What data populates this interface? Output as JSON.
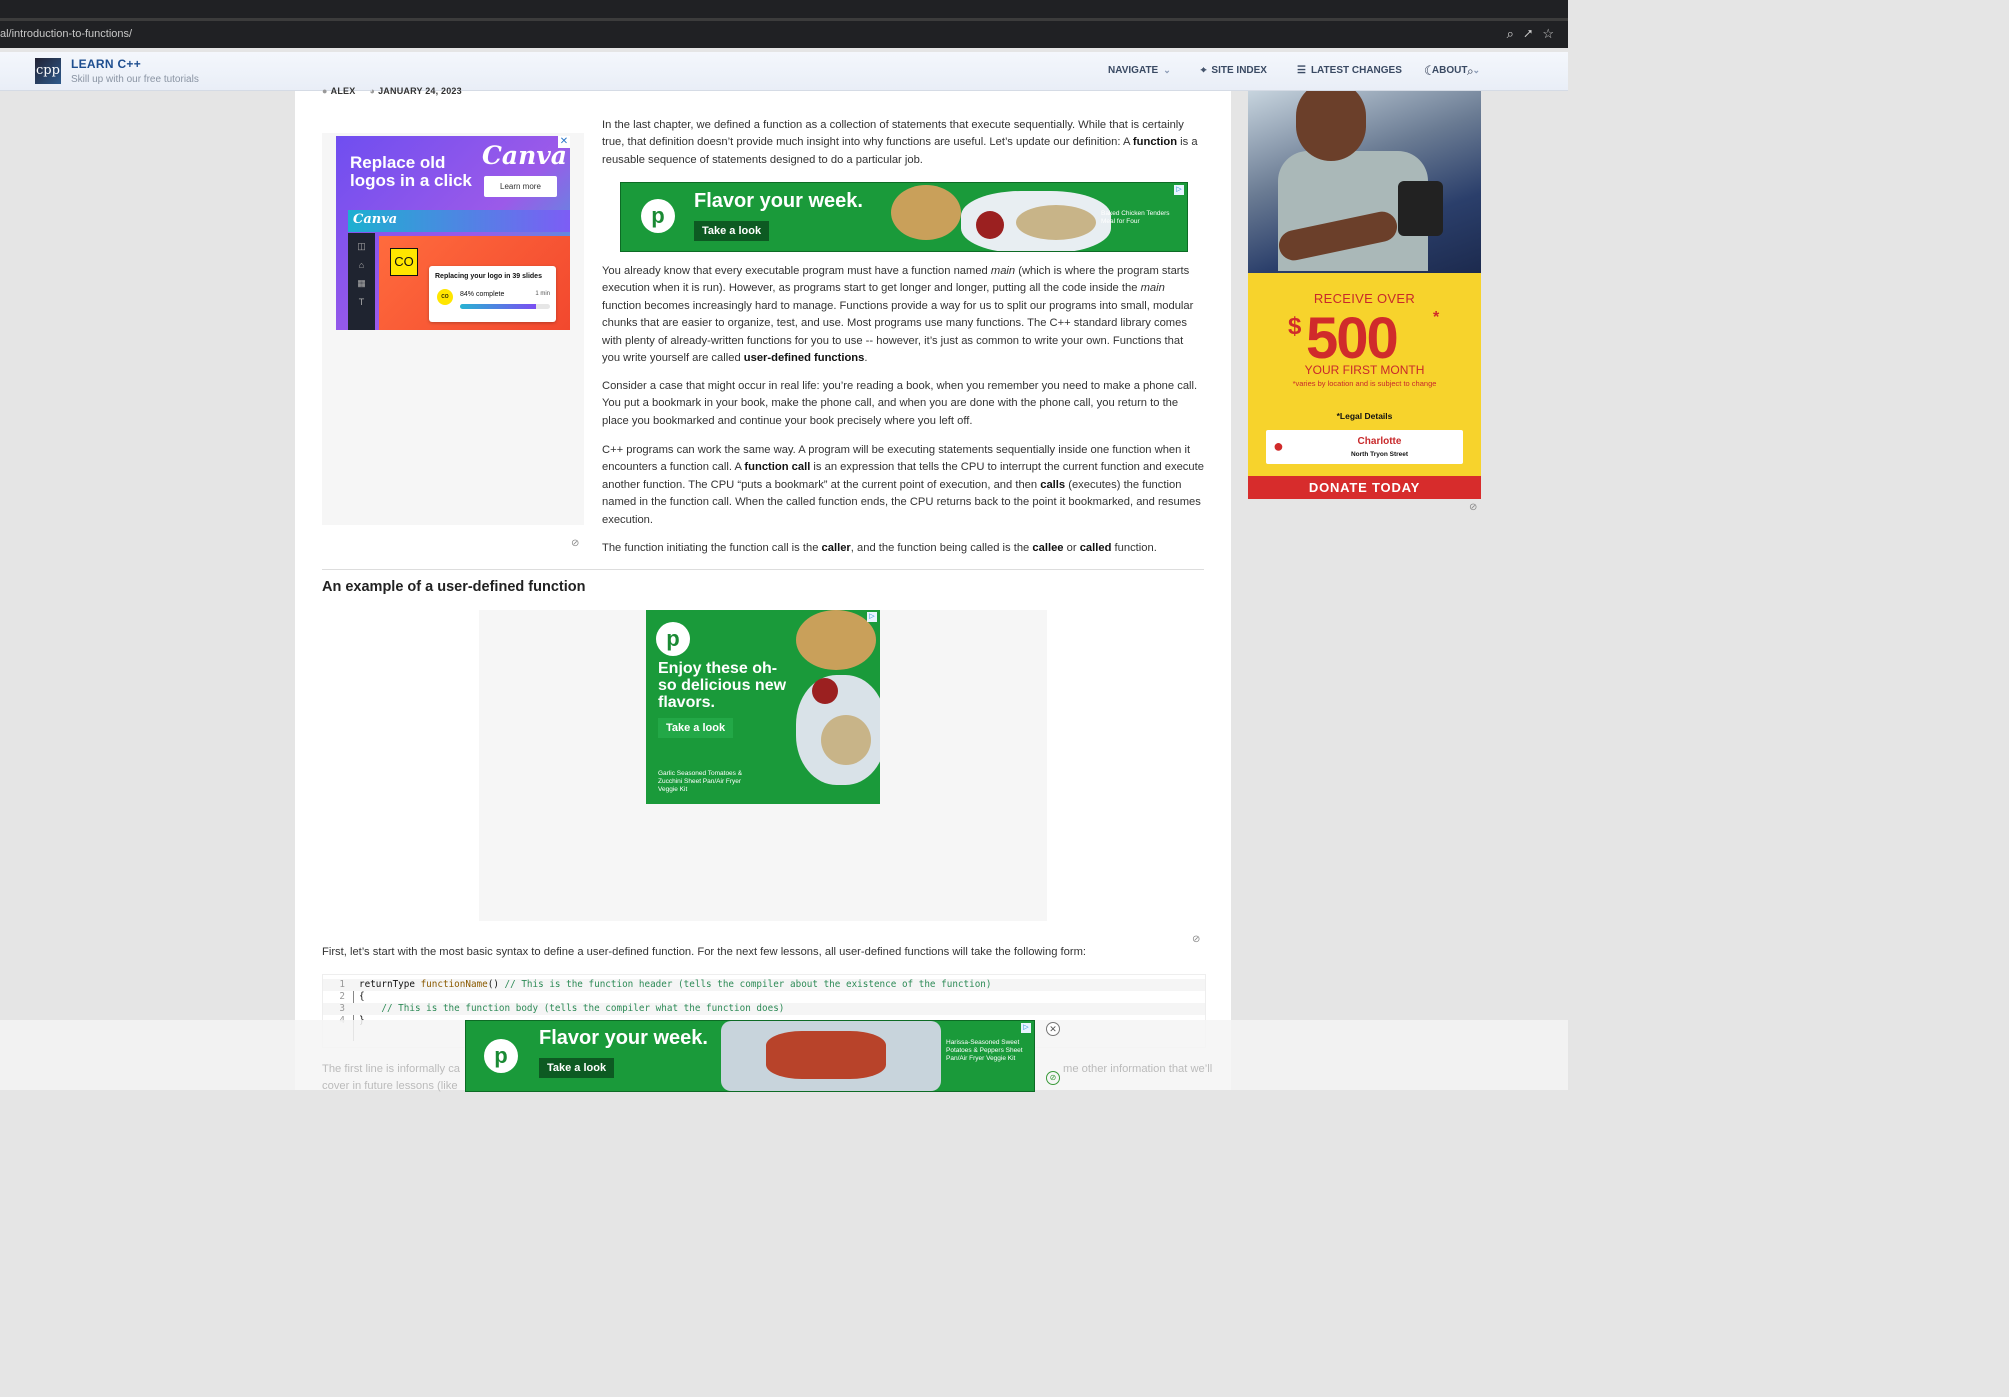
{
  "browser": {
    "url": "al/introduction-to-functions/",
    "icons": [
      "search-icon",
      "share-icon",
      "star-icon"
    ]
  },
  "site": {
    "logo_text": "cpp",
    "brand": "LEARN C++",
    "tagline": "Skill up with our free tutorials",
    "nav": [
      {
        "label": "NAVIGATE",
        "icon": "chevron-down-icon"
      },
      {
        "label": "SITE INDEX",
        "icon": "crosshair-icon"
      },
      {
        "label": "LATEST CHANGES",
        "icon": "list-icon"
      },
      {
        "label": "ABOUT",
        "icon": "chevron-down-icon"
      }
    ]
  },
  "article": {
    "author": "ALEX",
    "date": "JANUARY 24, 2023",
    "heading": "An example of a user-defined function",
    "intro_line": "First, let’s start with the most basic syntax to define a user-defined function. For the next few lessons, all user-defined functions will take the following form:",
    "fade_left": "The first line is informally ca",
    "fade_left2": "cover in future lessons (like",
    "fade_right": "me other information that we’ll"
  },
  "code": {
    "lines": [
      {
        "n": "1",
        "kw": "returnType ",
        "fn": "functionName",
        "rest": "() ",
        "cm": "// This is the function header (tells the compiler about the existence of the function)"
      },
      {
        "n": "2",
        "kw": "{",
        "fn": "",
        "rest": "",
        "cm": ""
      },
      {
        "n": "3",
        "kw": "    ",
        "fn": "",
        "rest": "",
        "cm": "// This is the function body (tells the compiler what the function does)"
      },
      {
        "n": "4",
        "kw": "}",
        "fn": "",
        "rest": "",
        "cm": ""
      }
    ]
  },
  "ads": {
    "canva": {
      "headline": "Replace old logos in a click",
      "brand": "Canva",
      "button": "Learn more",
      "card_title": "Replacing your logo in 39 slides",
      "progress_label": "84% complete",
      "progress": 0.84,
      "time": "1 min",
      "co": "CO"
    },
    "publix_banner": {
      "title": "Flavor your week.",
      "button": "Take a look",
      "small": "Baked Chicken Tenders Meal for Four"
    },
    "publix_tall": {
      "title": "Enjoy these oh-so delicious new flavors.",
      "button": "Take a look",
      "small": "Garlic Seasoned Tomatoes & Zucchini Sheet Pan/Air Fryer Veggie Kit"
    },
    "publix_bottom": {
      "title": "Flavor your week.",
      "button": "Take a look",
      "small": "Harissa-Seasoned Sweet Potatoes & Peppers Sheet Pan/Air Fryer Veggie Kit"
    },
    "donate": {
      "receive": "RECEIVE OVER",
      "amount": "500",
      "dollar": "$",
      "star": "*",
      "first_month": "YOUR FIRST MONTH",
      "varies": "*varies by location and is subject to change",
      "legal": "*Legal Details",
      "city": "Charlotte",
      "street": "North Tryon Street",
      "cta": "DONATE TODAY"
    }
  },
  "colors": {
    "link": "#1e4e8f",
    "publix_green": "#1a9a3a",
    "donate_red": "#d72c2c",
    "donate_yellow": "#f7d32c"
  }
}
